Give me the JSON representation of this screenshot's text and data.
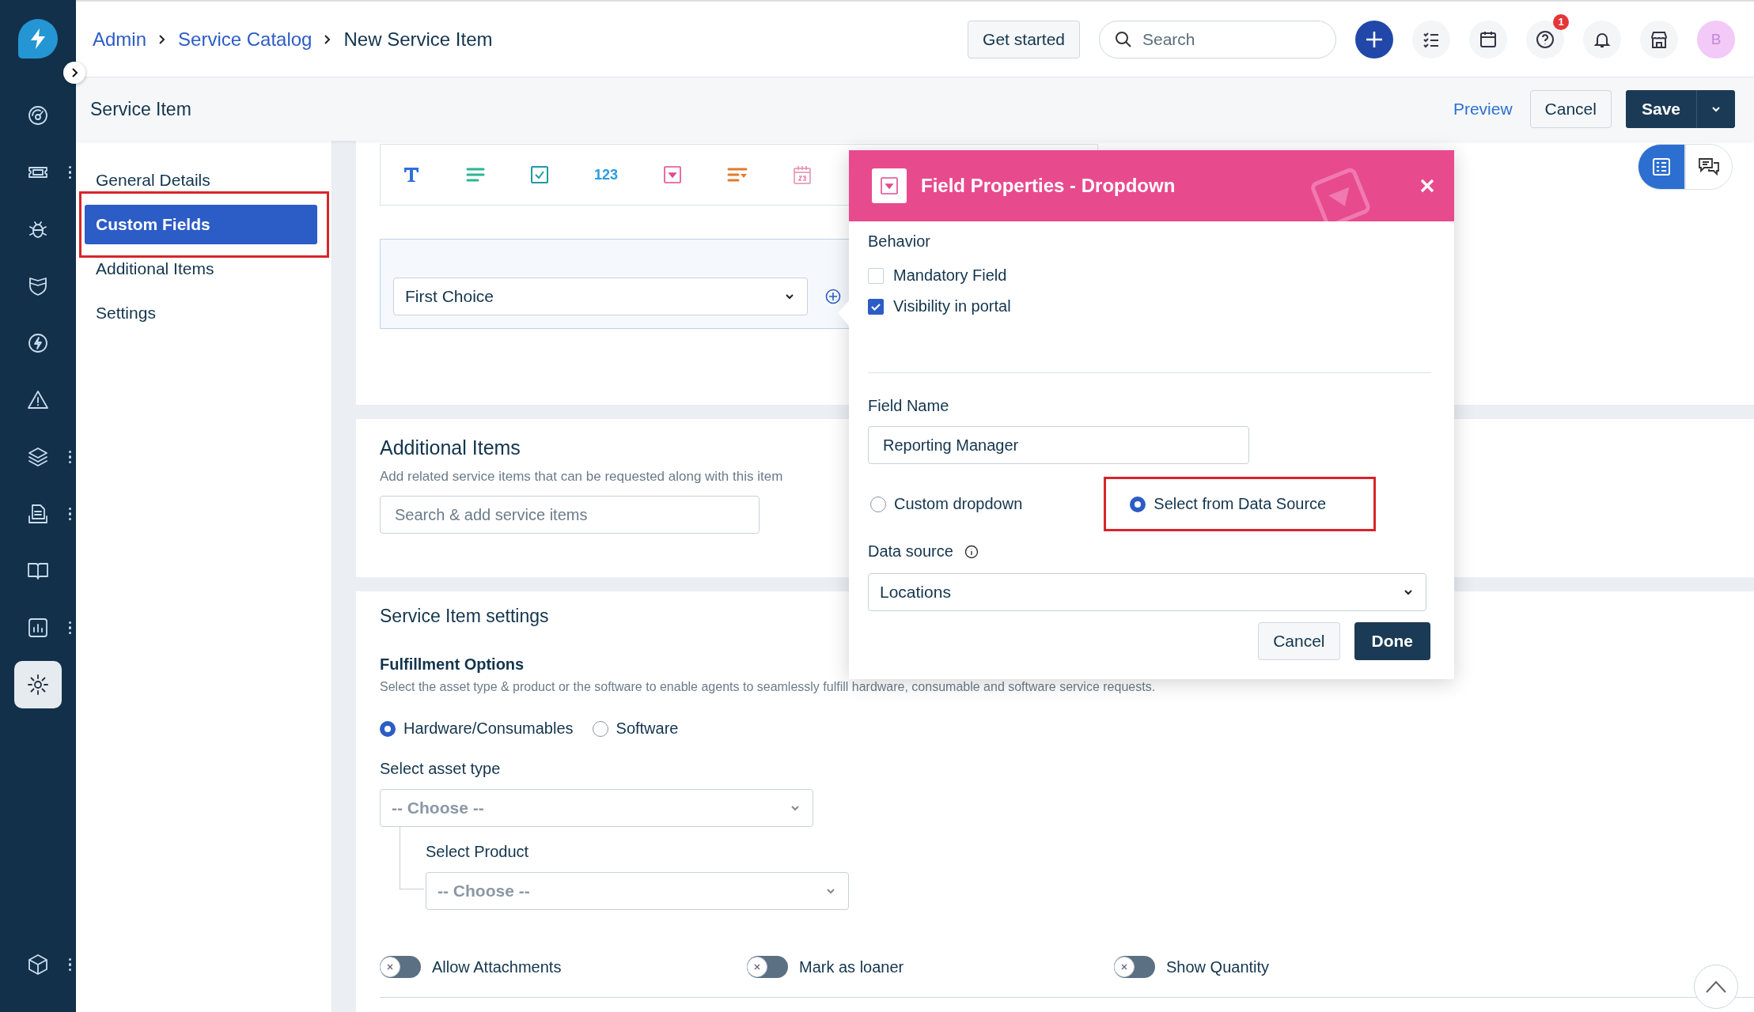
{
  "breadcrumb": [
    {
      "label": "Admin",
      "link": true
    },
    {
      "label": "Service Catalog",
      "link": true
    },
    {
      "label": "New Service Item",
      "link": false
    }
  ],
  "top_bar": {
    "get_started": "Get started",
    "search": {
      "placeholder": "Search"
    },
    "help_badge": "1",
    "avatar": "B"
  },
  "rail": {
    "items": [
      {
        "selected": false,
        "has_menu": false
      },
      {
        "selected": false,
        "has_menu": true
      },
      {
        "selected": false,
        "has_menu": false
      },
      {
        "selected": false,
        "has_menu": false
      },
      {
        "selected": false,
        "has_menu": false
      },
      {
        "selected": false,
        "has_menu": false
      },
      {
        "selected": false,
        "has_menu": true
      },
      {
        "selected": false,
        "has_menu": true
      },
      {
        "selected": false,
        "has_menu": false
      },
      {
        "selected": false,
        "has_menu": true
      },
      {
        "selected": true,
        "has_menu": false
      }
    ],
    "bottom_item": {
      "has_menu": true
    }
  },
  "page_header": {
    "title": "Service Item",
    "preview": "Preview",
    "cancel": "Cancel",
    "save": "Save"
  },
  "nav": {
    "items": [
      {
        "label": "General Details",
        "selected": false,
        "highlighted": false
      },
      {
        "label": "Custom Fields",
        "selected": true,
        "highlighted": true
      },
      {
        "label": "Additional Items",
        "selected": false,
        "highlighted": false
      },
      {
        "label": "Settings",
        "selected": false,
        "highlighted": false
      }
    ]
  },
  "view_switch": [
    {
      "selected": true
    },
    {
      "selected": false
    }
  ],
  "field_toolbar": [
    {
      "kind": "text"
    },
    {
      "kind": "paragraph"
    },
    {
      "kind": "checkbox"
    },
    {
      "kind": "number",
      "label": "123"
    },
    {
      "kind": "dropdown"
    },
    {
      "kind": "multiselect"
    },
    {
      "kind": "date"
    }
  ],
  "preview_field": {
    "value": "First Choice"
  },
  "additional_items": {
    "title": "Additional Items",
    "description": "Add related service items that can be requested along with this item",
    "search": {
      "placeholder": "Search & add service items"
    }
  },
  "settings": {
    "title": "Service Item settings",
    "fulfillment": {
      "title": "Fulfillment Options",
      "description": "Select the asset type & product or the software to enable agents to seamlessly fulfill hardware, consumable and software service requests.",
      "options": [
        {
          "label": "Hardware/Consumables",
          "selected": true
        },
        {
          "label": "Software",
          "selected": false
        }
      ]
    },
    "asset_type": {
      "label": "Select asset type",
      "placeholder": "-- Choose --"
    },
    "product": {
      "label": "Select Product",
      "placeholder": "-- Choose --"
    },
    "toggles": [
      {
        "label": "Allow Attachments",
        "on": false
      },
      {
        "label": "Mark as loaner",
        "on": false
      },
      {
        "label": "Show Quantity",
        "on": false
      }
    ]
  },
  "modal": {
    "title": "Field Properties - Dropdown",
    "behavior_label": "Behavior",
    "checkboxes": [
      {
        "label": "Mandatory Field",
        "checked": false
      },
      {
        "label": "Visibility in portal",
        "checked": true
      }
    ],
    "field_name": {
      "label": "Field Name",
      "value": "Reporting Manager"
    },
    "source_options": [
      {
        "label": "Custom dropdown",
        "selected": false,
        "highlighted": false
      },
      {
        "label": "Select from Data Source",
        "selected": true,
        "highlighted": true
      }
    ],
    "data_source": {
      "label": "Data source",
      "value": "Locations"
    },
    "cancel": "Cancel",
    "done": "Done"
  }
}
